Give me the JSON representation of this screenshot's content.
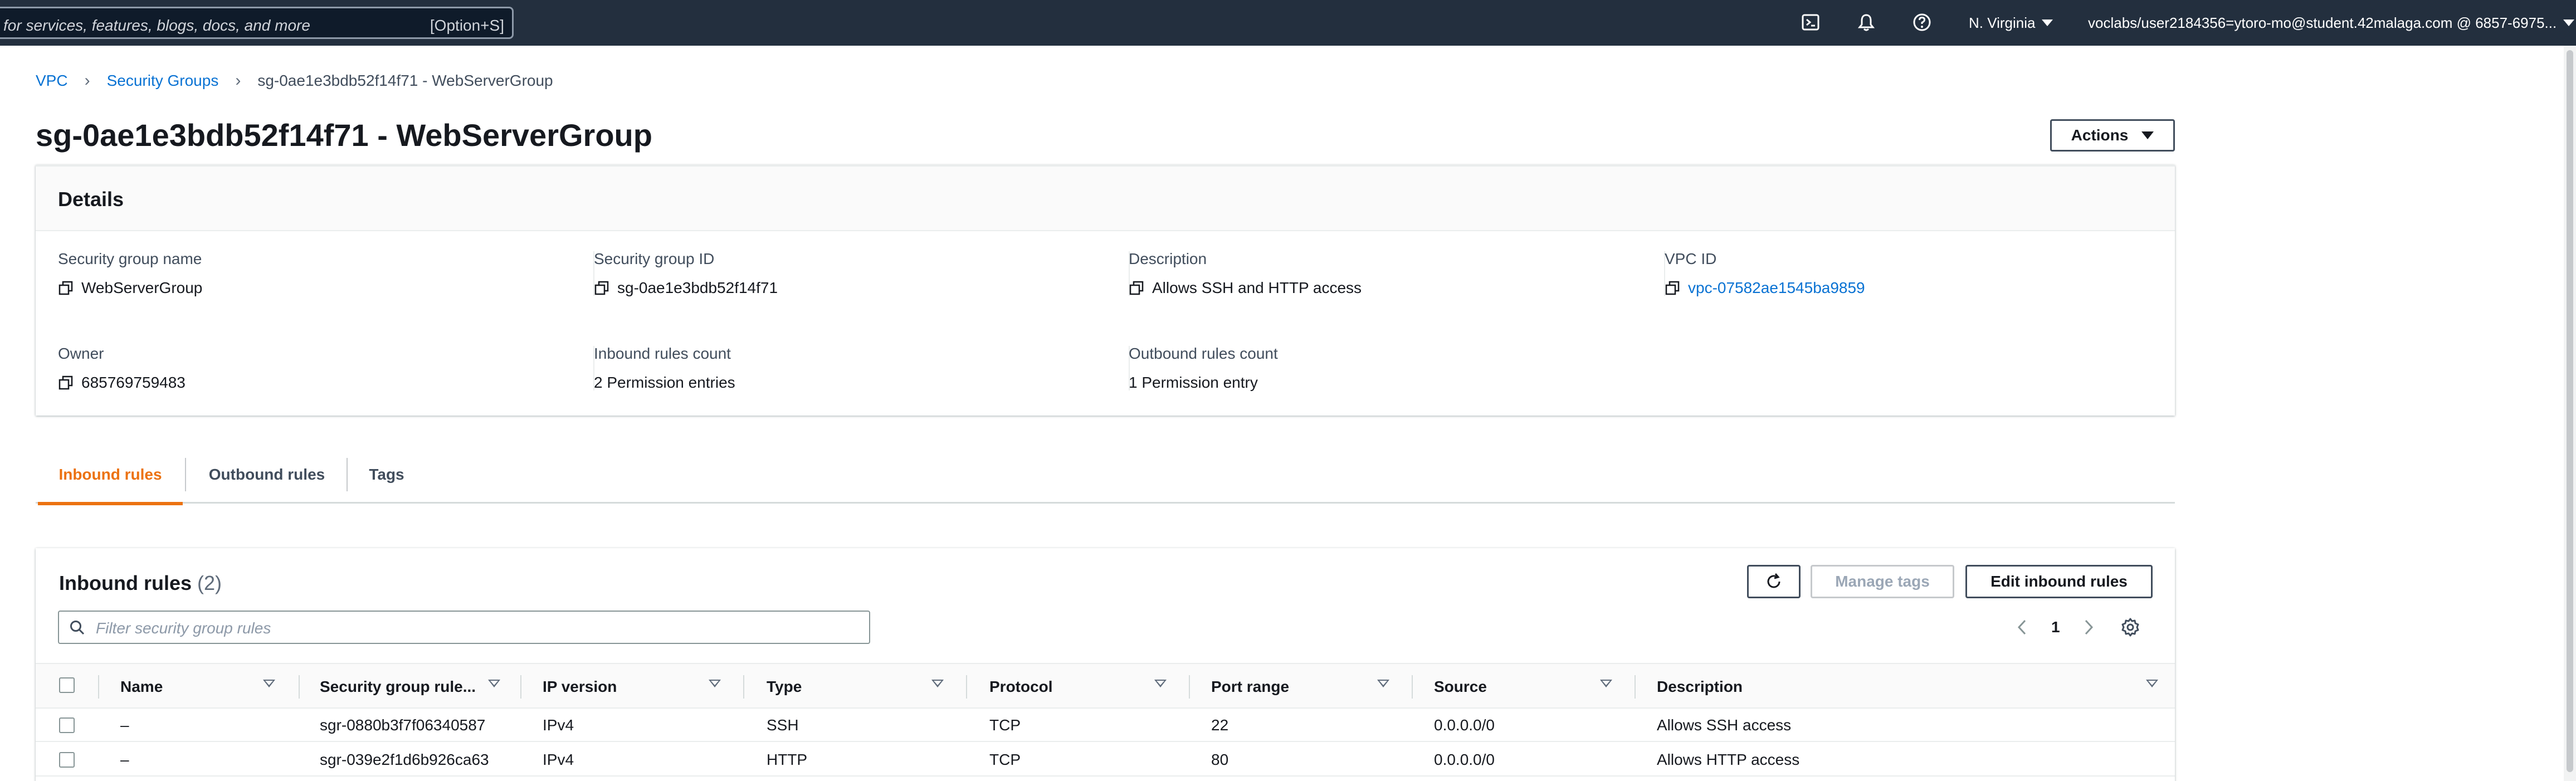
{
  "topnav": {
    "search_placeholder": "for services, features, blogs, docs, and more",
    "search_shortcut": "[Option+S]",
    "region": "N. Virginia",
    "account": "voclabs/user2184356=ytoro-mo@student.42malaga.com @ 6857-6975...",
    "icons": [
      "cloudshell-icon",
      "notifications-bell-icon",
      "help-icon"
    ]
  },
  "breadcrumb": {
    "items": [
      {
        "label": "VPC"
      },
      {
        "label": "Security Groups"
      },
      {
        "label": "sg-0ae1e3bdb52f14f71 - WebServerGroup"
      }
    ]
  },
  "page": {
    "title": "sg-0ae1e3bdb52f14f71 - WebServerGroup",
    "actions_label": "Actions"
  },
  "details": {
    "title": "Details",
    "fields": [
      {
        "label": "Security group name",
        "value": "WebServerGroup"
      },
      {
        "label": "Security group ID",
        "value": "sg-0ae1e3bdb52f14f71"
      },
      {
        "label": "Description",
        "value": "Allows SSH and HTTP access"
      },
      {
        "label": "VPC ID",
        "value": "vpc-07582ae1545ba9859"
      },
      {
        "label": "Owner",
        "value": "685769759483"
      },
      {
        "label": "Inbound rules count",
        "value": "2 Permission entries"
      },
      {
        "label": "Outbound rules count",
        "value": "1 Permission entry"
      }
    ]
  },
  "tabs": [
    {
      "label": "Inbound rules",
      "active": true
    },
    {
      "label": "Outbound rules",
      "active": false
    },
    {
      "label": "Tags",
      "active": false
    }
  ],
  "inbound": {
    "title": "Inbound rules",
    "count": "(2)",
    "manage_tags_label": "Manage tags",
    "edit_label": "Edit inbound rules",
    "filter_placeholder": "Filter security group rules",
    "page": "1",
    "columns": [
      "Name",
      "Security group rule...",
      "IP version",
      "Type",
      "Protocol",
      "Port range",
      "Source",
      "Description"
    ],
    "rows": [
      {
        "name": "–",
        "rule_id": "sgr-0880b3f7f06340587",
        "ip_version": "IPv4",
        "type": "SSH",
        "protocol": "TCP",
        "port_range": "22",
        "source": "0.0.0.0/0",
        "description": "Allows SSH access"
      },
      {
        "name": "–",
        "rule_id": "sgr-039e2f1d6b926ca63",
        "ip_version": "IPv4",
        "type": "HTTP",
        "protocol": "TCP",
        "port_range": "80",
        "source": "0.0.0.0/0",
        "description": "Allows HTTP access"
      }
    ]
  },
  "colors": {
    "nav_bg": "#232f3e",
    "link": "#0972d3",
    "active_tab": "#ec7211",
    "text": "#16191f"
  }
}
